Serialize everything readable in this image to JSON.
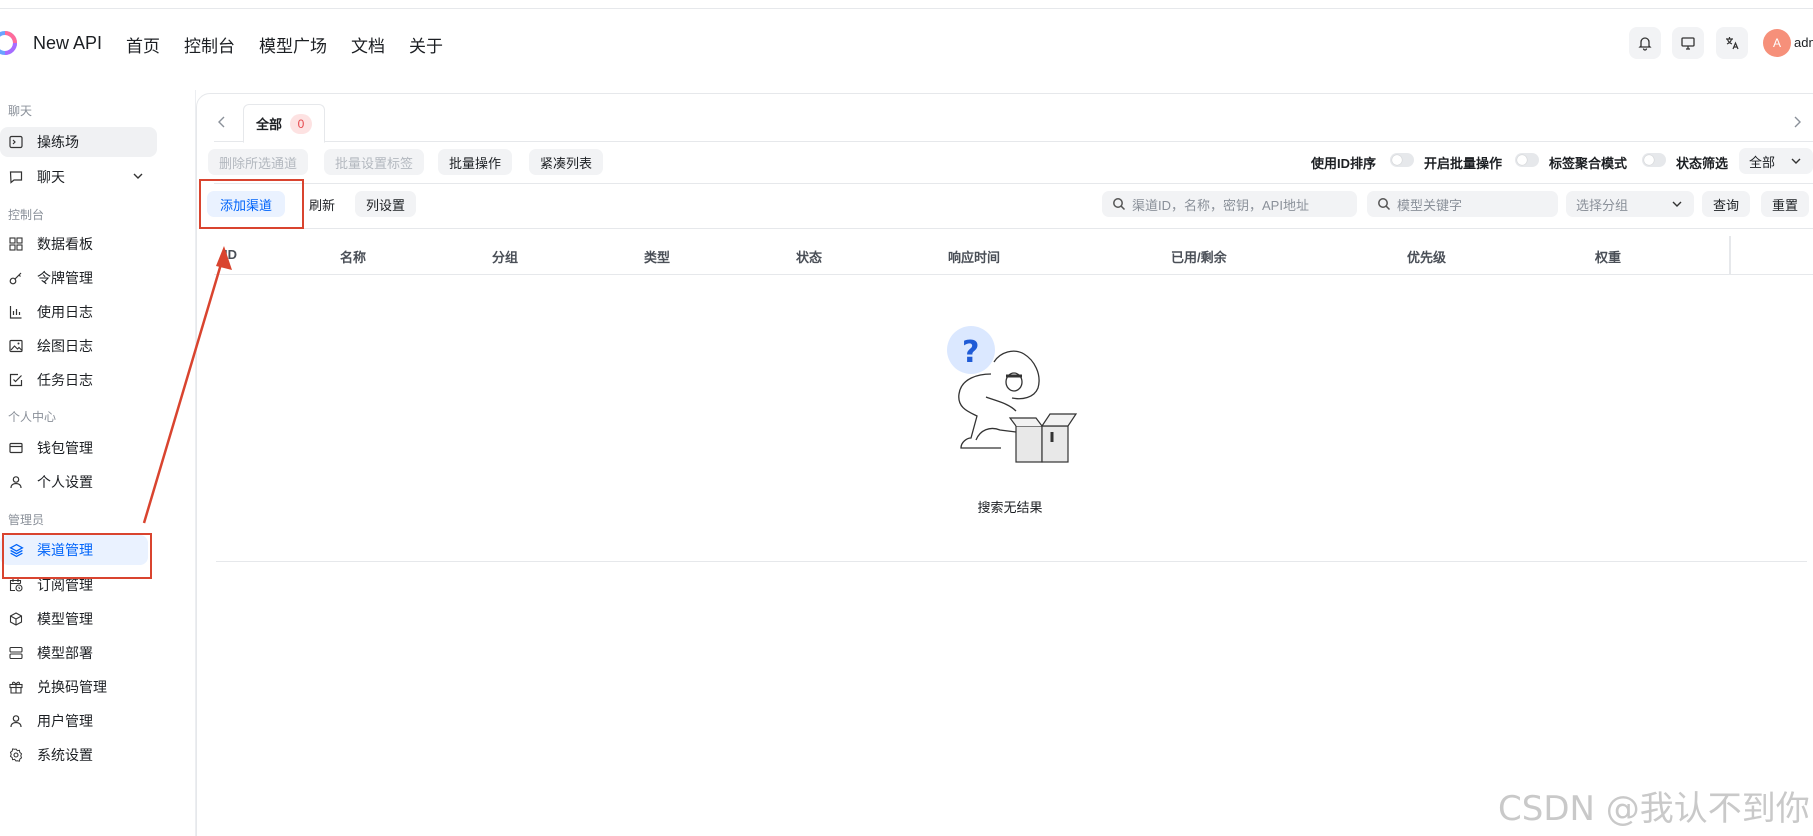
{
  "header": {
    "brand": "New API",
    "nav": [
      "首页",
      "控制台",
      "模型广场",
      "文档",
      "关于"
    ],
    "avatar_initial": "A",
    "username": "admin"
  },
  "sidebar": {
    "sections": {
      "chat": "聊天",
      "console": "控制台",
      "personal": "个人中心",
      "admin": "管理员"
    },
    "items": {
      "playground": "操练场",
      "chat": "聊天",
      "dashboard": "数据看板",
      "tokens": "令牌管理",
      "usage_log": "使用日志",
      "drawing_log": "绘图日志",
      "task_log": "任务日志",
      "wallet": "钱包管理",
      "settings_personal": "个人设置",
      "channels": "渠道管理",
      "subscriptions": "订阅管理",
      "models": "模型管理",
      "model_deploy": "模型部署",
      "redeem": "兑换码管理",
      "users": "用户管理",
      "system": "系统设置"
    }
  },
  "tabs": {
    "all_label": "全部",
    "all_count": "0"
  },
  "toolbar": {
    "delete_selected": "删除所选通道",
    "batch_tag": "批量设置标签",
    "batch_ops": "批量操作",
    "compact_list": "紧凑列表",
    "sort_by_id": "使用ID排序",
    "batch_mode": "开启批量操作",
    "tag_aggregate": "标签聚合模式",
    "status_filter": "状态筛选",
    "status_value": "全部",
    "add_channel": "添加渠道",
    "refresh": "刷新",
    "column_settings": "列设置",
    "search_placeholder": "渠道ID，名称，密钥，API地址",
    "model_placeholder": "模型关键字",
    "group_placeholder": "选择分组",
    "query": "查询",
    "reset": "重置"
  },
  "table": {
    "columns": [
      "ID",
      "名称",
      "分组",
      "类型",
      "状态",
      "响应时间",
      "已用/剩余",
      "优先级",
      "权重"
    ],
    "empty_text": "搜索无结果"
  },
  "watermark": "CSDN @我认不到你",
  "colors": {
    "accent": "#0064fa",
    "annotation": "#d9442f",
    "badge_bg": "#fde2e2",
    "badge_text": "#e5484d"
  }
}
